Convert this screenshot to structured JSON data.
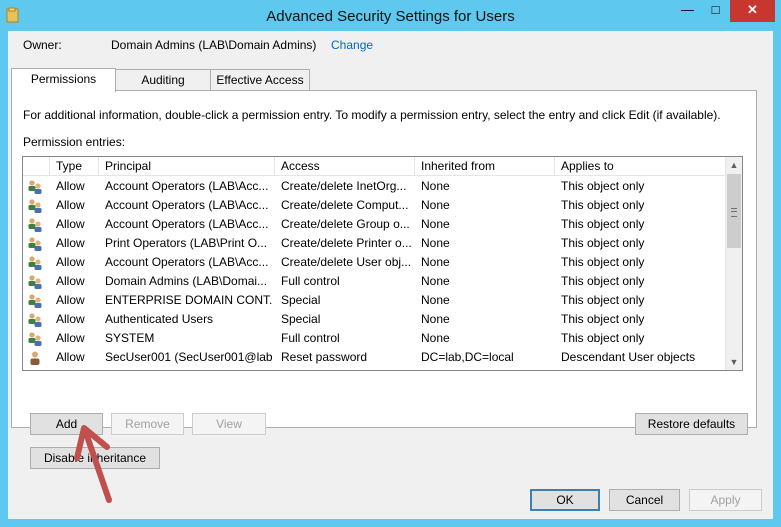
{
  "window": {
    "title": "Advanced Security Settings for Users"
  },
  "owner": {
    "label": "Owner:",
    "value": "Domain Admins (LAB\\Domain Admins)",
    "change": "Change"
  },
  "tabs": [
    {
      "label": "Permissions",
      "active": true
    },
    {
      "label": "Auditing",
      "active": false
    },
    {
      "label": "Effective Access",
      "active": false
    }
  ],
  "permissions": {
    "info": "For additional information, double-click a permission entry. To modify a permission entry, select the entry and click Edit (if available).",
    "entries_label": "Permission entries:",
    "columns": [
      "Type",
      "Principal",
      "Access",
      "Inherited from",
      "Applies to"
    ],
    "rows": [
      {
        "icon": "group",
        "type": "Allow",
        "principal": "Account Operators (LAB\\Acc...",
        "access": "Create/delete InetOrg...",
        "inherited": "None",
        "applies": "This object only"
      },
      {
        "icon": "group",
        "type": "Allow",
        "principal": "Account Operators (LAB\\Acc...",
        "access": "Create/delete Comput...",
        "inherited": "None",
        "applies": "This object only"
      },
      {
        "icon": "group",
        "type": "Allow",
        "principal": "Account Operators (LAB\\Acc...",
        "access": "Create/delete Group o...",
        "inherited": "None",
        "applies": "This object only"
      },
      {
        "icon": "group",
        "type": "Allow",
        "principal": "Print Operators (LAB\\Print O...",
        "access": "Create/delete Printer o...",
        "inherited": "None",
        "applies": "This object only"
      },
      {
        "icon": "group",
        "type": "Allow",
        "principal": "Account Operators (LAB\\Acc...",
        "access": "Create/delete User obj...",
        "inherited": "None",
        "applies": "This object only"
      },
      {
        "icon": "group",
        "type": "Allow",
        "principal": "Domain Admins (LAB\\Domai...",
        "access": "Full control",
        "inherited": "None",
        "applies": "This object only"
      },
      {
        "icon": "group",
        "type": "Allow",
        "principal": "ENTERPRISE DOMAIN CONT...",
        "access": "Special",
        "inherited": "None",
        "applies": "This object only"
      },
      {
        "icon": "group",
        "type": "Allow",
        "principal": "Authenticated Users",
        "access": "Special",
        "inherited": "None",
        "applies": "This object only"
      },
      {
        "icon": "group",
        "type": "Allow",
        "principal": "SYSTEM",
        "access": "Full control",
        "inherited": "None",
        "applies": "This object only"
      },
      {
        "icon": "user",
        "type": "Allow",
        "principal": "SecUser001 (SecUser001@lab....",
        "access": "Reset password",
        "inherited": "DC=lab,DC=local",
        "applies": "Descendant User objects"
      }
    ],
    "buttons": {
      "add": "Add",
      "remove": "Remove",
      "view": "View",
      "restore": "Restore defaults",
      "disable": "Disable inheritance"
    }
  },
  "footer": {
    "ok": "OK",
    "cancel": "Cancel",
    "apply": "Apply"
  },
  "colors": {
    "titlebar": "#5ec8ee",
    "close": "#c7372f",
    "link": "#0066cc",
    "annotation_arrow": "#c0504d"
  }
}
